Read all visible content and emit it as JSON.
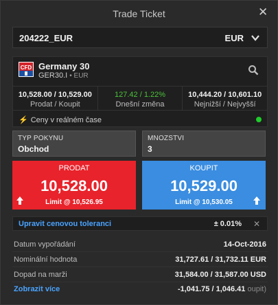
{
  "window": {
    "title": "Trade Ticket"
  },
  "account": {
    "id": "204222_EUR",
    "currency": "EUR"
  },
  "market": {
    "name": "Germany 30",
    "symbol": "GER30.I",
    "exchange": "EUR",
    "stats": [
      {
        "value": "10,528.00 / 10,529.00",
        "label": "Prodat / Koupit"
      },
      {
        "value": "127.42 / 1.22%",
        "label": "Dnešní změna"
      },
      {
        "value": "10,444.20 / 10,601.10",
        "label": "Nejnižší / Nejvyšší"
      }
    ],
    "realtime_label": "Ceny v reálném čase"
  },
  "order": {
    "type_label": "TYP POKYNU",
    "type_value": "Obchod",
    "qty_label": "MNOZSTVI",
    "qty_value": "3"
  },
  "sell": {
    "label": "PRODAT",
    "price": "10,528.00",
    "limit": "Limit @ 10,526.95"
  },
  "buy": {
    "label": "KOUPIT",
    "price": "10,529.00",
    "limit": "Limit @ 10,530.05"
  },
  "tolerance": {
    "link": "Upravit cenovou toleranci",
    "value": "± 0.01%"
  },
  "details": [
    {
      "label": "Datum vypořádání",
      "value": "14-Oct-2016",
      "unit": ""
    },
    {
      "label": "Nominální hodnota",
      "value": "31,727.61 / 31,732.11",
      "unit": "EUR"
    },
    {
      "label": "Dopad na marži",
      "value": "31,584.00 / 31,587.00",
      "unit": "USD"
    },
    {
      "label": "Zobrazit více",
      "value": "-1,041.75 / 1,046.41",
      "unit": "oupit)"
    }
  ],
  "colors": {
    "sell": "#e8232b",
    "buy": "#3a8de0",
    "link": "#4aa3ff",
    "positive": "#4cc23a"
  },
  "icons": [
    "close-icon",
    "chevron-down-icon",
    "cfd-logo-icon",
    "search-icon",
    "lightning-icon",
    "up-arrow-icon"
  ]
}
